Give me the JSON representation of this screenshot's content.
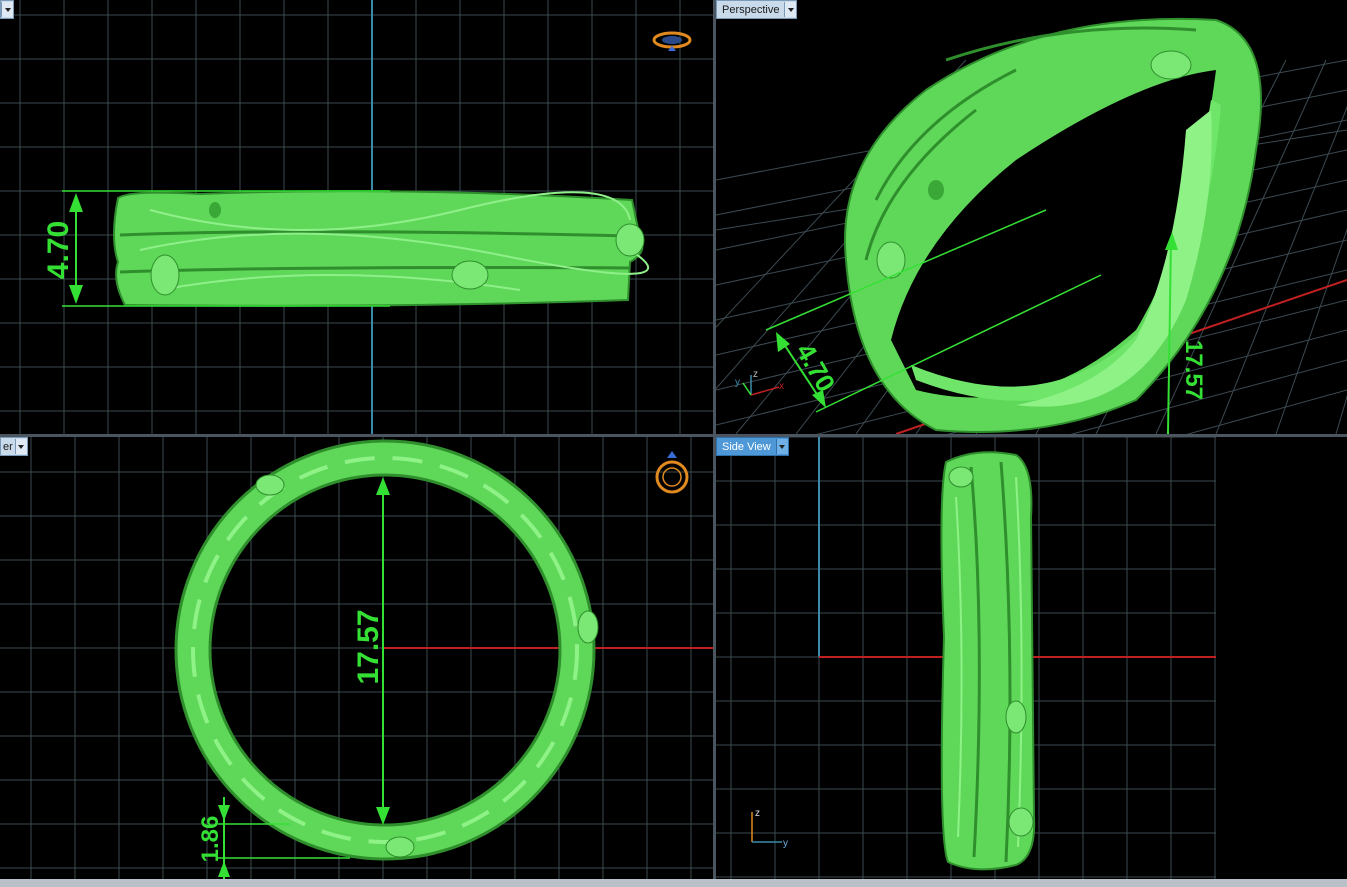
{
  "viewports": {
    "top_left": {
      "label": "",
      "dimension": "4.70"
    },
    "top_right": {
      "label": "Perspective",
      "dimension_height": "4.70",
      "dimension_diameter": "17.57",
      "axis_labels": {
        "x": "x",
        "y": "y",
        "z": "z"
      }
    },
    "bottom_left": {
      "label": "er",
      "dimension_diameter": "17.57",
      "dimension_thickness": "1.86"
    },
    "bottom_right": {
      "label": "Side View",
      "axis_labels": {
        "y": "y",
        "z": "z"
      }
    }
  },
  "colors": {
    "model": "#5fd85a",
    "model_dark": "#2f8f2c",
    "dimension": "#35e035",
    "grid": "#3c4a52",
    "axis_red": "#c02020",
    "axis_blue": "#3a8aa8",
    "background": "#000000"
  },
  "icons": {
    "ring_front_icon": "ring-front-icon",
    "ring_top_icon": "ring-top-icon"
  }
}
